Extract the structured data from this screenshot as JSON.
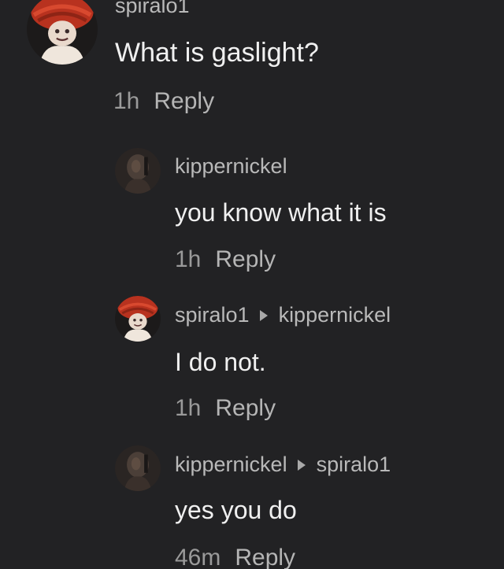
{
  "comments": [
    {
      "username": "spiralo1",
      "text": "What is gaslight?",
      "time": "1h",
      "reply_label": "Reply"
    },
    {
      "username": "kippernickel",
      "text": "you know what it is",
      "time": "1h",
      "reply_label": "Reply"
    },
    {
      "username": "spiralo1",
      "reply_to": "kippernickel",
      "text": "I do not.",
      "time": "1h",
      "reply_label": "Reply"
    },
    {
      "username": "kippernickel",
      "reply_to": "spiralo1",
      "text": "yes you do",
      "time": "46m",
      "reply_label": "Reply"
    }
  ],
  "icons": {
    "reply_arrow": "caret-right-icon",
    "avatar_spiralo1": "avatar-red-hat",
    "avatar_kippernickel": "avatar-dark"
  },
  "colors": {
    "background": "#222224",
    "username": "#b9b9b9",
    "text": "#f0f0f0",
    "meta": "#9a9a9a"
  }
}
